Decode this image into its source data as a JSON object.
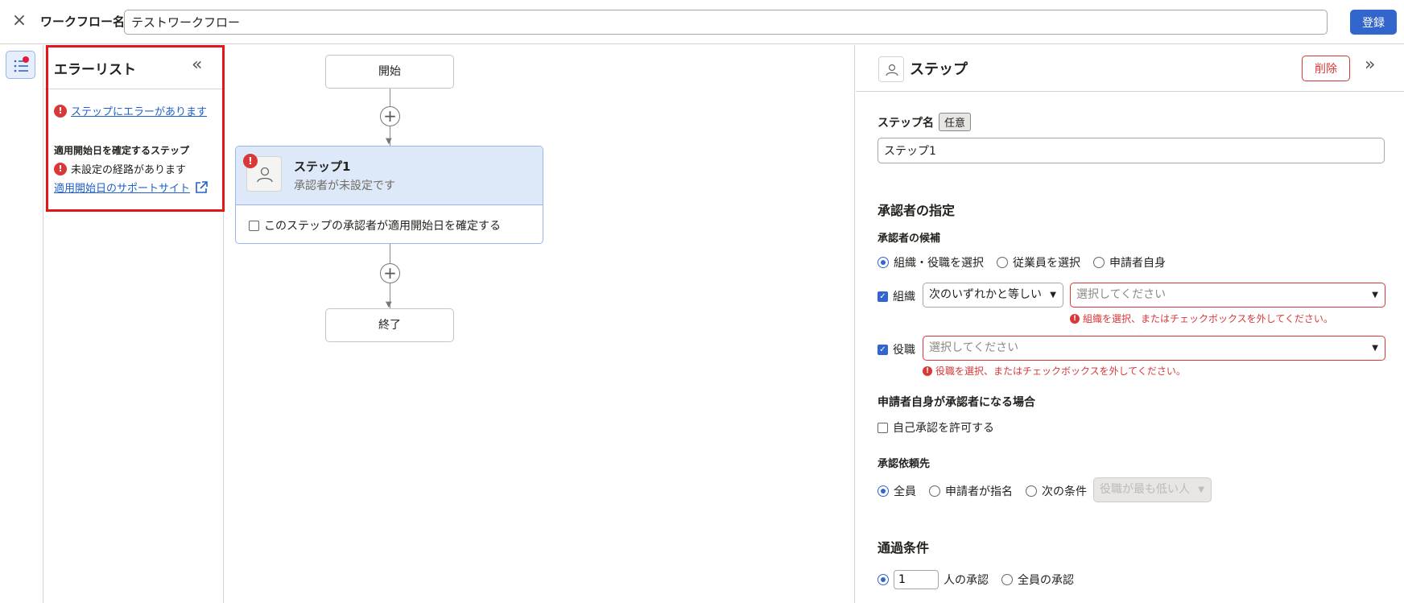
{
  "header": {
    "close_icon": "×",
    "workflow_label": "ワークフロー名",
    "workflow_name": "テストワークフロー",
    "register_label": "登録"
  },
  "rail": {
    "icon": "list-icon"
  },
  "error_list": {
    "title": "エラーリスト",
    "collapse_icon": "«",
    "step_error_link": "ステップにエラーがあります",
    "section_title": "適用開始日を確定するステップ",
    "route_error": "未設定の経路があります",
    "support_link": "適用開始日のサポートサイト"
  },
  "flow": {
    "start_label": "開始",
    "end_label": "終了",
    "step": {
      "name": "ステップ1",
      "subtitle": "承認者が未設定です",
      "checkbox_label": "このステップの承認者が適用開始日を確定する"
    }
  },
  "panel": {
    "title": "ステップ",
    "delete_label": "削除",
    "expand_icon": "»",
    "step_name_label": "ステップ名",
    "optional_badge": "任意",
    "step_name_value": "ステップ1",
    "approver_heading": "承認者の指定",
    "candidate_label": "承認者の候補",
    "candidate_options": [
      "組織・役職を選択",
      "従業員を選択",
      "申請者自身"
    ],
    "org_label": "組織",
    "org_condition": "次のいずれかと等しい",
    "org_placeholder": "選択してください",
    "org_error": "組織を選択、またはチェックボックスを外してください。",
    "role_label": "役職",
    "role_placeholder": "選択してください",
    "role_error": "役職を選択、またはチェックボックスを外してください。",
    "self_heading": "申請者自身が承認者になる場合",
    "self_checkbox": "自己承認を許可する",
    "request_label": "承認依頼先",
    "request_options": [
      "全員",
      "申請者が指名",
      "次の条件"
    ],
    "request_condition": "役職が最も低い人",
    "pass_heading": "通過条件",
    "pass_count": "1",
    "pass_suffix": "人の承認",
    "pass_all": "全員の承認"
  },
  "colors": {
    "accent": "#3366cc",
    "error": "#d93838",
    "highlight": "#e8141c"
  }
}
